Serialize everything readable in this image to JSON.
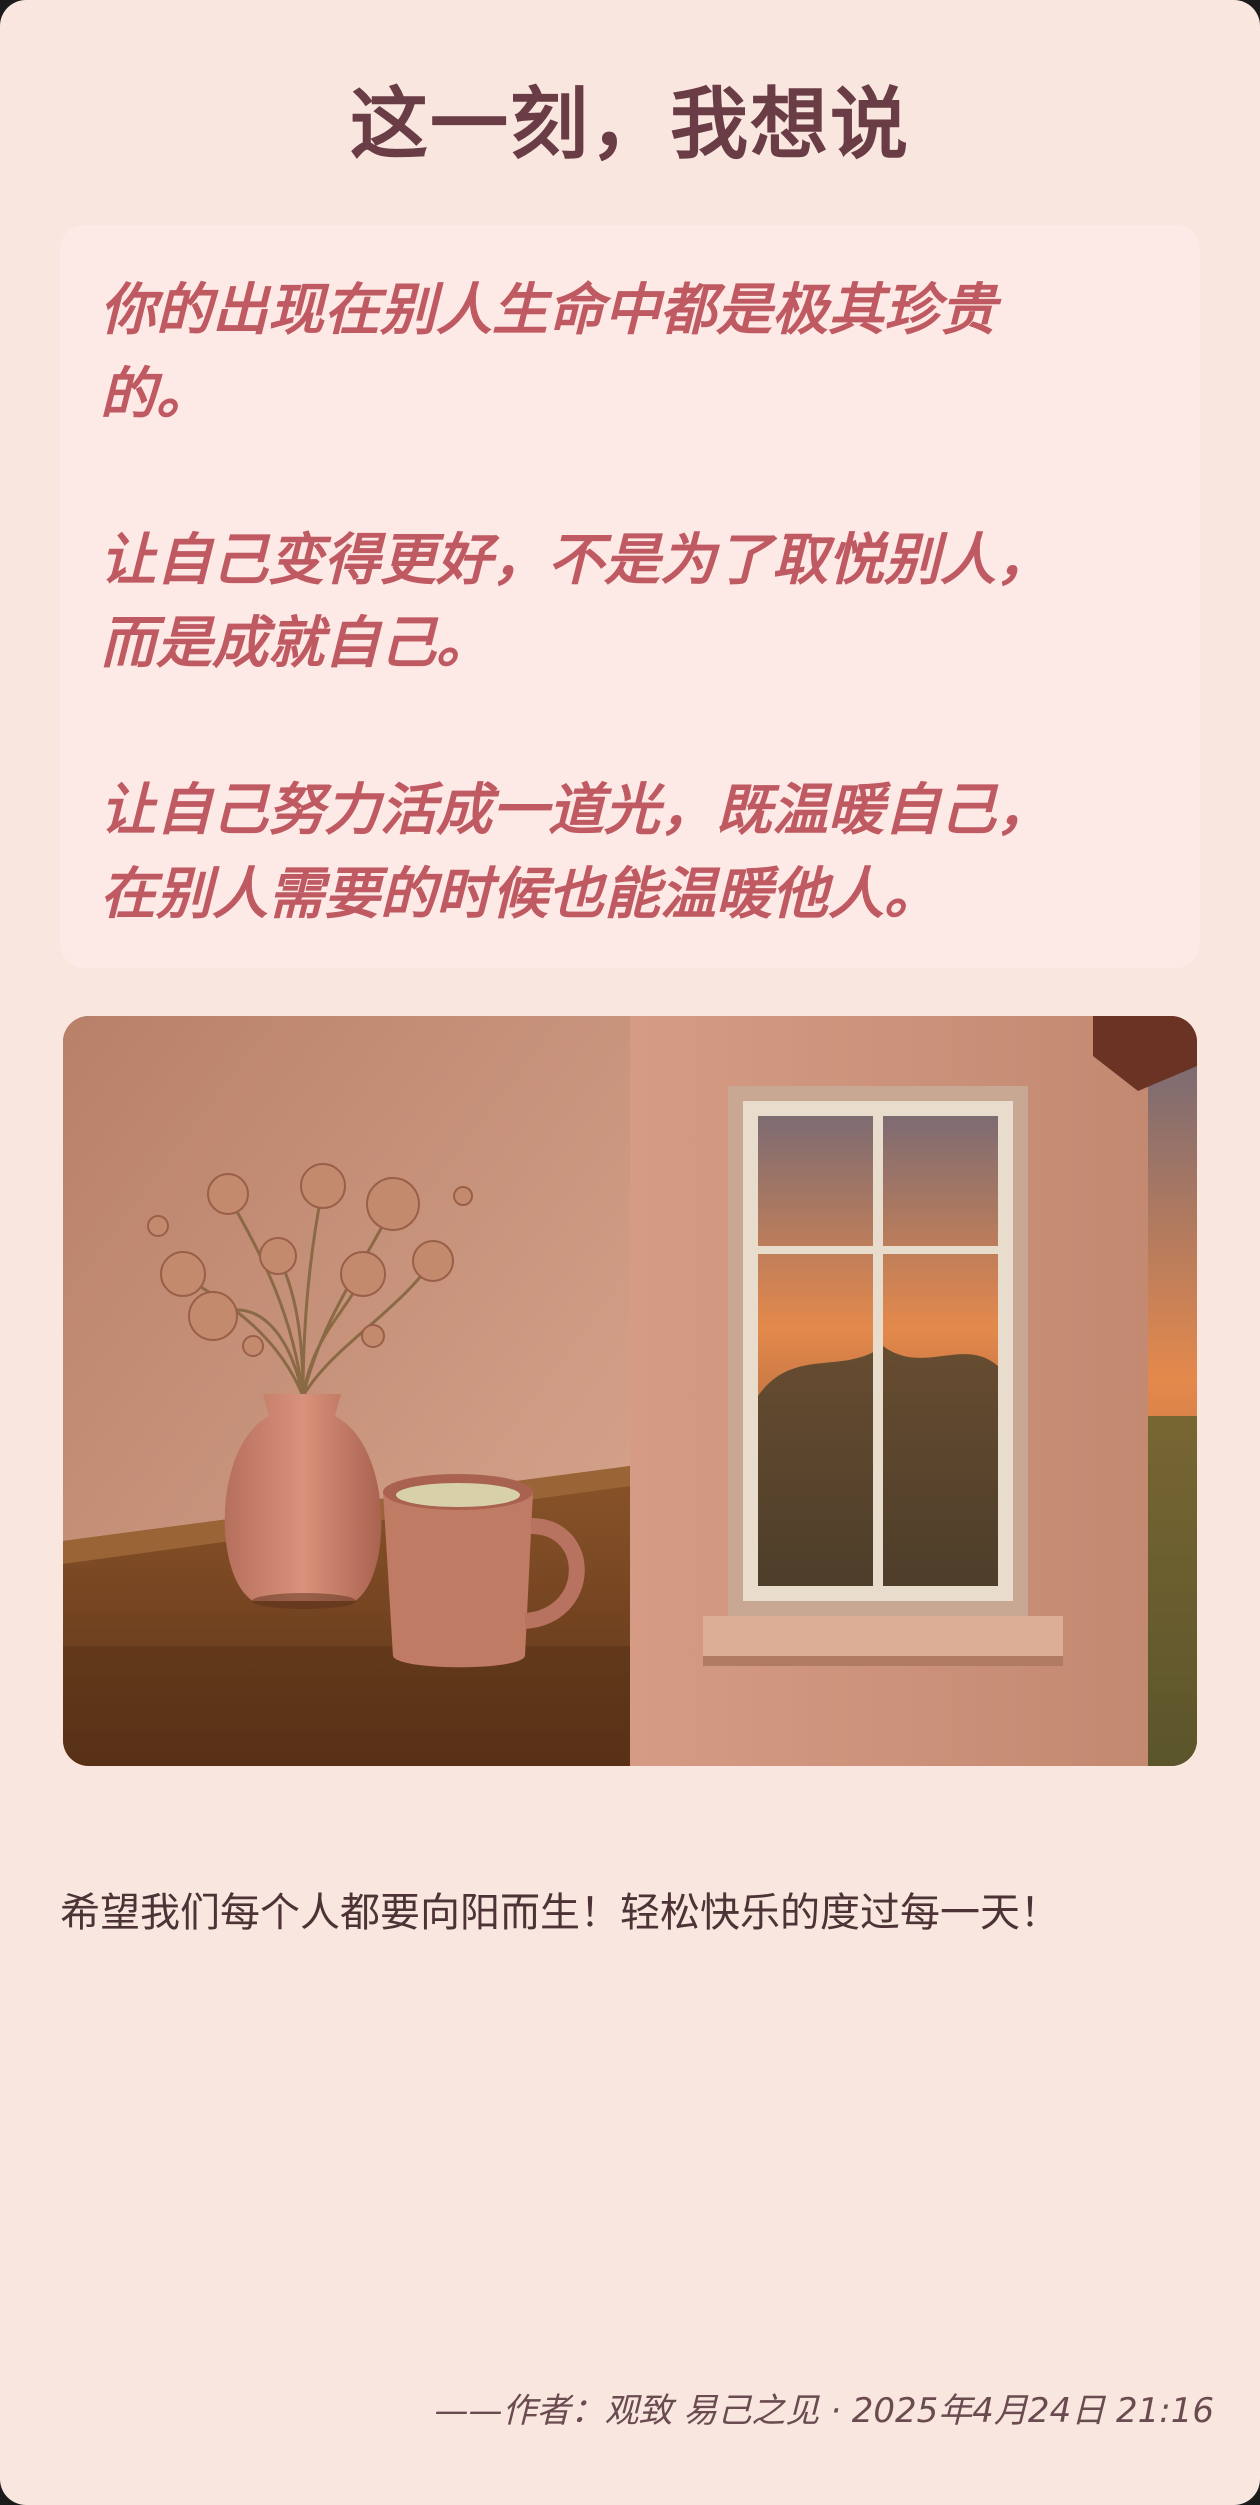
{
  "post": {
    "title": "这一刻，我想说",
    "quote_lines": [
      "你的出现在别人生命中都是极其珍贵",
      "的。",
      "让自己变得更好，不是为了取悦别人，",
      "而是成就自己。",
      "让自己努力活成一道光，既温暖自己，",
      "在别人需要的时候也能温暖他人。"
    ],
    "wish": "希望我们每个人都要向阳而生！轻松快乐的度过每一天！",
    "footer": "——作者：观致 易己之见 · 2025年4月24日 21:16"
  },
  "colors": {
    "background": "#f8e6df",
    "quote_box": "#fde9e5",
    "quote_text": "#c05a62",
    "title_text": "#6a3c45"
  }
}
